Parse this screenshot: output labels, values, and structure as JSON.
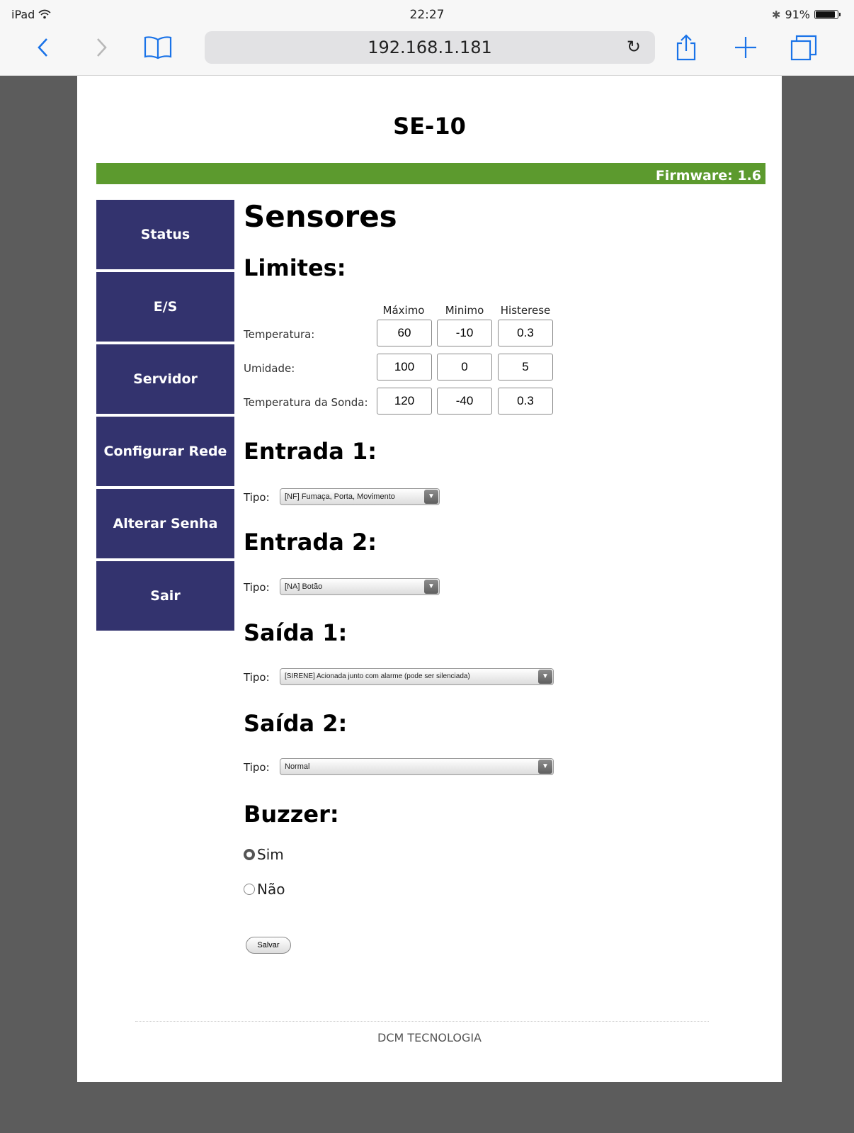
{
  "status_bar": {
    "device": "iPad",
    "time": "22:27",
    "battery": "91%"
  },
  "browser": {
    "url": "192.168.1.181"
  },
  "site": {
    "title": "SE-10",
    "firmware": "Firmware: 1.6",
    "footer": "DCM TECNOLOGIA"
  },
  "sidebar": {
    "items": [
      {
        "label": "Status"
      },
      {
        "label": "E/S"
      },
      {
        "label": "Servidor"
      },
      {
        "label": "Configurar Rede"
      },
      {
        "label": "Alterar Senha"
      },
      {
        "label": "Sair"
      }
    ]
  },
  "main": {
    "title": "Sensores",
    "limits": {
      "heading": "Limites:",
      "columns": [
        "Máximo",
        "Minimo",
        "Histerese"
      ],
      "rows": [
        {
          "label": "Temperatura:",
          "values": [
            "60",
            "-10",
            "0.3"
          ]
        },
        {
          "label": "Umidade:",
          "values": [
            "100",
            "0",
            "5"
          ]
        },
        {
          "label": "Temperatura da Sonda:",
          "values": [
            "120",
            "-40",
            "0.3"
          ]
        }
      ]
    },
    "tipo_label": "Tipo:",
    "entrada1": {
      "heading": "Entrada 1:",
      "value": "[NF] Fumaça, Porta, Movimento"
    },
    "entrada2": {
      "heading": "Entrada 2:",
      "value": "[NA] Botão"
    },
    "saida1": {
      "heading": "Saída 1:",
      "value": "[SIRENE] Acionada junto com alarme (pode ser silenciada)"
    },
    "saida2": {
      "heading": "Saída 2:",
      "value": "Normal"
    },
    "buzzer": {
      "heading": "Buzzer:",
      "options": [
        "Sim",
        "Não"
      ],
      "selected": "Sim"
    },
    "save_label": "Salvar"
  }
}
